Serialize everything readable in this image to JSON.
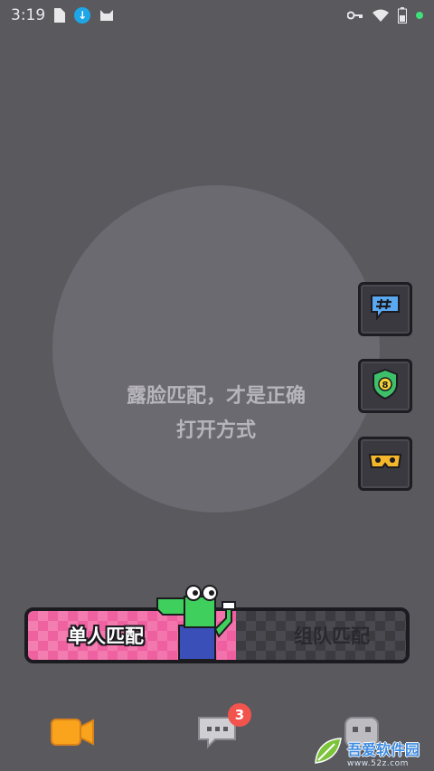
{
  "status_bar": {
    "time": "3:19",
    "left_icons": [
      "sim-icon",
      "download-icon",
      "cat-icon"
    ],
    "right_icons": [
      "key-icon",
      "wifi-icon",
      "battery-icon",
      "dot-icon"
    ]
  },
  "camera": {
    "hint_line1": "露脸匹配，才是正确",
    "hint_line2": "打开方式"
  },
  "side_buttons": [
    {
      "name": "hashtag-chat-icon"
    },
    {
      "name": "shield-badge-icon"
    },
    {
      "name": "mask-icon"
    }
  ],
  "match": {
    "single_label": "单人匹配",
    "team_label": "组队匹配"
  },
  "tabs": [
    {
      "name": "camera-tab-icon",
      "color": "#f9a41c"
    },
    {
      "name": "messages-tab-icon",
      "badge": "3"
    },
    {
      "name": "profile-tab-icon"
    }
  ],
  "watermark": {
    "title": "吾爱软件园",
    "url": "www.52z.com"
  },
  "colors": {
    "background": "#5a595e",
    "circle": "#6b6a70",
    "single_match_pink": "#ef62a0",
    "team_match_dark": "#3c3b40",
    "tab_camera_orange": "#f9a41c",
    "badge_red": "#f2544d"
  }
}
